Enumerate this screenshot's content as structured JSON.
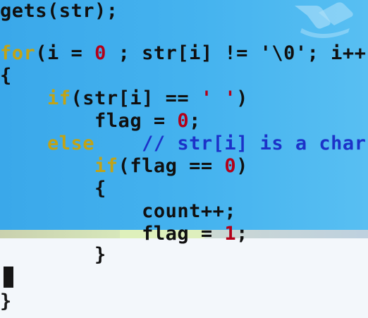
{
  "editor": {
    "colors": {
      "background": "#45b3ef",
      "keyword": "#c2a315",
      "number": "#b40018",
      "comment": "#1c32c8",
      "text": "#101010",
      "lower_area": "#f3f7fb",
      "cursor": "#111111"
    },
    "watermark_icon": "hand-logo-icon",
    "lines": {
      "l1": {
        "a": "gets(str);"
      },
      "l2": {
        "kw": "for",
        "a": "(i = ",
        "n": "0",
        "b": " ; str[i] != '\\0'; i++)"
      },
      "l3": {
        "a": "{"
      },
      "l4": {
        "indent": "    ",
        "kw": "if",
        "a": "(str[i] == ",
        "s": "' '",
        "b": ")"
      },
      "l5": {
        "indent": "        ",
        "a": "flag = ",
        "n": "0",
        "b": ";"
      },
      "l6": {
        "indent": "    ",
        "kw": "else",
        "gap": "    ",
        "c": "// str[i] is a char"
      },
      "l7": {
        "indent": "        ",
        "kw": "if",
        "a": "(flag == ",
        "n": "0",
        "b": ")"
      },
      "l8": {
        "indent": "        ",
        "a": "{"
      },
      "l9": {
        "indent": "            ",
        "a": "count++;"
      },
      "l10": {
        "indent": "            ",
        "a": "flag = ",
        "n": "1",
        "b": ";"
      },
      "l11": {
        "indent": "        ",
        "a": "}"
      },
      "l12": {
        "a": "}"
      }
    }
  }
}
